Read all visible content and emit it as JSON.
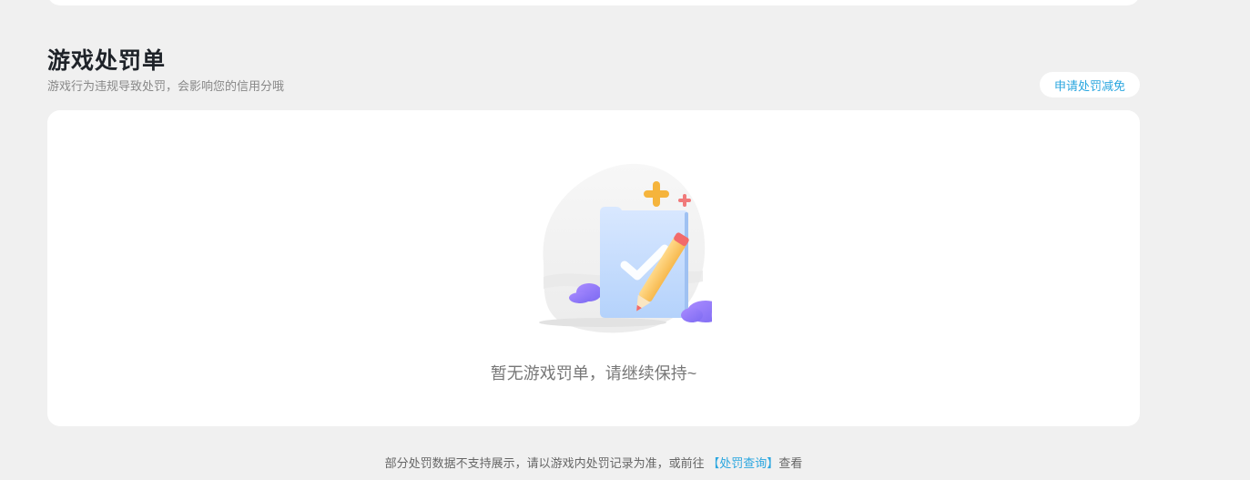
{
  "section": {
    "title": "游戏处罚单",
    "subtitle": "游戏行为违规导致处罚，会影响您的信用分哦",
    "appeal_button": "申请处罚减免"
  },
  "empty_state": {
    "illustration": "empty-document-check-pencil",
    "message": "暂无游戏罚单，请继续保持~"
  },
  "footer": {
    "text_before": "部分处罚数据不支持展示，请以游戏内处罚记录为准，或前往",
    "link_text": "【处罚查询】",
    "text_after": "查看"
  },
  "colors": {
    "background": "#f0f0f0",
    "card": "#ffffff",
    "accent": "#2aa6df",
    "title": "#1f2329"
  }
}
